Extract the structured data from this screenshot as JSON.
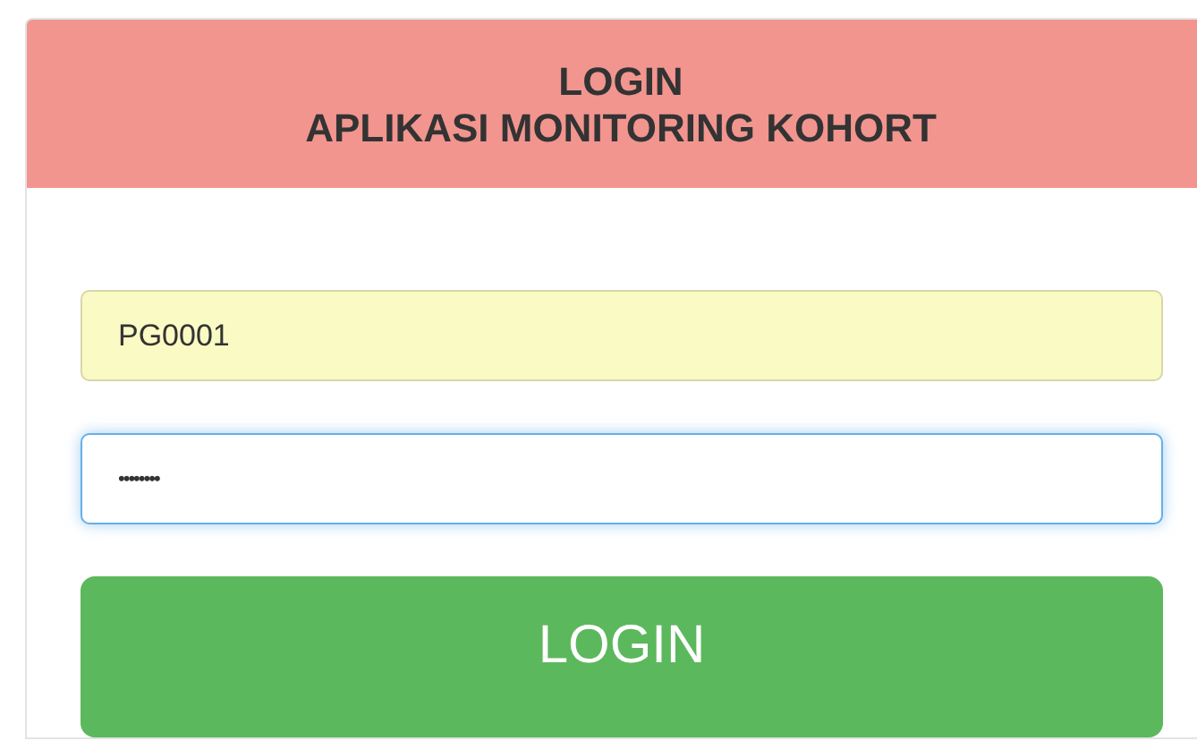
{
  "header": {
    "title_lines": [
      "LOGIN",
      "APLIKASI MONITORING KOHORT"
    ]
  },
  "fields": [
    {
      "kind": "username",
      "value": "PG0001",
      "focused": false,
      "autofilled": true
    },
    {
      "kind": "password",
      "value": "••••••••",
      "focused": true,
      "autofilled": false
    }
  ],
  "button": {
    "label": "LOGIN"
  }
}
